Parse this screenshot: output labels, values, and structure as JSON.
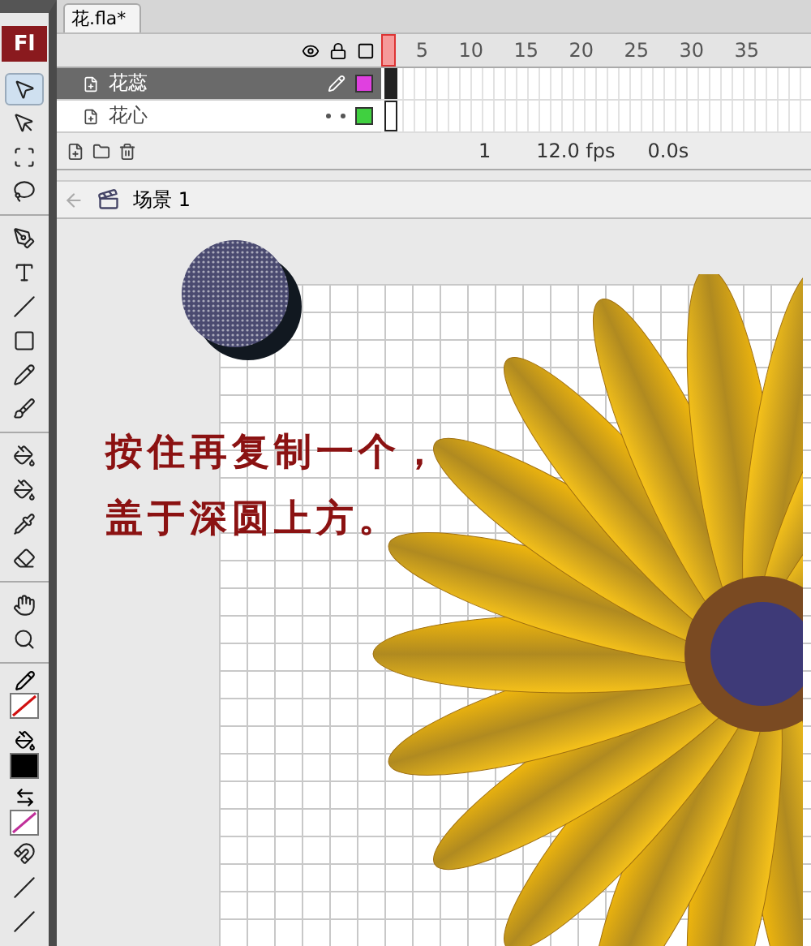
{
  "document_tab": {
    "title": "花.fla*",
    "selected": true
  },
  "logo": "Fl",
  "tool_groups": [
    [
      {
        "kind": "select",
        "selected": true
      },
      {
        "kind": "subselect",
        "selected": false
      },
      {
        "kind": "transform",
        "selected": false
      },
      {
        "kind": "lasso",
        "selected": false
      }
    ],
    [
      {
        "kind": "pen",
        "selected": false
      },
      {
        "kind": "text",
        "selected": false
      },
      {
        "kind": "line",
        "selected": false
      },
      {
        "kind": "rect",
        "selected": false
      },
      {
        "kind": "pencil",
        "selected": false
      },
      {
        "kind": "brush",
        "selected": false
      }
    ],
    [
      {
        "kind": "inkbottle",
        "selected": false
      },
      {
        "kind": "bucket",
        "selected": false
      },
      {
        "kind": "eyedropper",
        "selected": false
      },
      {
        "kind": "eraser",
        "selected": false
      }
    ],
    [
      {
        "kind": "hand",
        "selected": false
      },
      {
        "kind": "zoom",
        "selected": false
      }
    ]
  ],
  "options": [
    {
      "kind": "magnet",
      "selected": false
    },
    {
      "kind": "smooth",
      "selected": false
    },
    {
      "kind": "straighten",
      "selected": false
    }
  ],
  "timeline": {
    "ruler": [
      "5",
      "10",
      "15",
      "20",
      "25",
      "30",
      "35"
    ],
    "layers": [
      {
        "name": "花蕊",
        "selected": true,
        "color": "#e040e0"
      },
      {
        "name": "花心",
        "selected": false,
        "color": "#40d040"
      }
    ],
    "frame": "1",
    "fps": "12.0 fps",
    "time": "0.0s"
  },
  "scene": "场景 1",
  "caption": [
    "按住再复制一个，",
    "盖于深圆上方。"
  ]
}
